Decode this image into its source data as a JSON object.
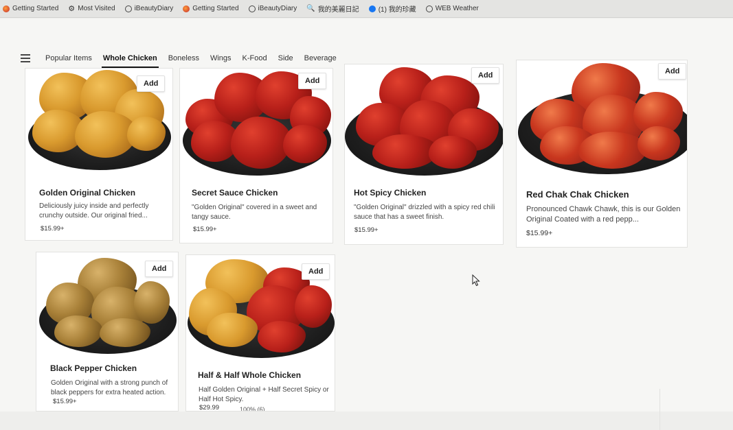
{
  "bookmarks": [
    {
      "label": "Getting Started",
      "icon": "firefox-icon"
    },
    {
      "label": "Most Visited",
      "icon": "gear-icon"
    },
    {
      "label": "iBeautyDiary",
      "icon": "globe-icon"
    },
    {
      "label": "Getting Started",
      "icon": "firefox-icon"
    },
    {
      "label": "iBeautyDiary",
      "icon": "globe-icon"
    },
    {
      "label": "我的美麗日記",
      "icon": "key-icon"
    },
    {
      "label": "(1) 我的珍藏",
      "icon": "facebook-icon"
    },
    {
      "label": "WEB Weather",
      "icon": "globe-icon"
    }
  ],
  "tabs": [
    {
      "label": "Popular Items"
    },
    {
      "label": "Whole Chicken",
      "active": true
    },
    {
      "label": "Boneless"
    },
    {
      "label": "Wings"
    },
    {
      "label": "K-Food"
    },
    {
      "label": "Side"
    },
    {
      "label": "Beverage"
    }
  ],
  "add_label": "Add",
  "items": [
    {
      "name": "Golden Original Chicken",
      "desc": "Deliciously juicy inside and perfectly crunchy outside. Our original fried...",
      "price": "$15.99+"
    },
    {
      "name": "Secret Sauce Chicken",
      "desc": "\"Golden Original\" covered in a sweet and tangy sauce.",
      "price": "$15.99+"
    },
    {
      "name": "Hot Spicy Chicken",
      "desc": "\"Golden Original\" drizzled with a spicy red chili sauce that has a sweet finish.",
      "price": "$15.99+"
    },
    {
      "name": "Red Chak Chak Chicken",
      "desc": "Pronounced Chawk Chawk, this is our Golden Original Coated with a red pepp...",
      "price": "$15.99+"
    },
    {
      "name": "Black Pepper Chicken",
      "desc": "Golden Original with a strong punch of black peppers for extra heated action.",
      "price": "$15.99+"
    },
    {
      "name": "Half & Half Whole Chicken",
      "desc": "Half Golden Original + Half Secret Spicy or Half Hot Spicy.",
      "price": "$29.99"
    }
  ],
  "half_half_meta": "100% (6)"
}
